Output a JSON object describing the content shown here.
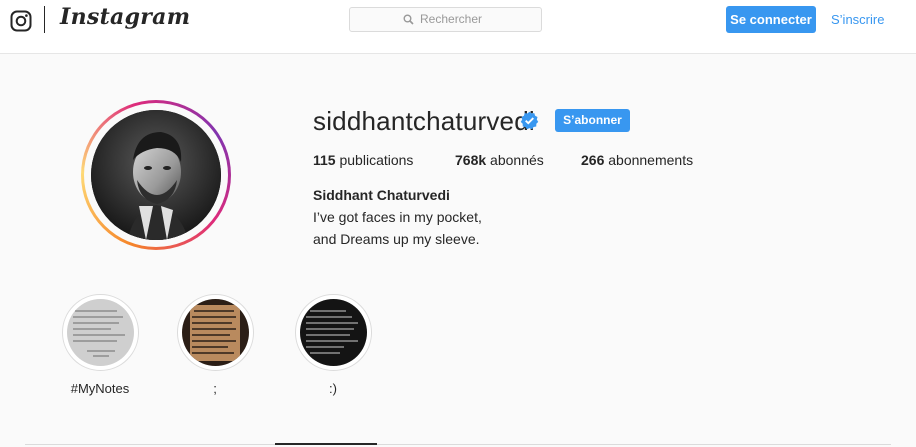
{
  "header": {
    "logo_text": "Instagram",
    "search_placeholder": "Rechercher",
    "login_label": "Se connecter",
    "signup_label": "S’inscrire"
  },
  "profile": {
    "username": "siddhantchaturvedi",
    "verified": true,
    "follow_label": "S’abonner",
    "stats": [
      {
        "count": "115",
        "label": "publications"
      },
      {
        "count": "768k",
        "label": "abonnés"
      },
      {
        "count": "266",
        "label": "abonnements"
      }
    ],
    "full_name": "Siddhant Chaturvedi",
    "bio_lines": [
      "I’ve got faces in my pocket,",
      "and Dreams up my sleeve."
    ]
  },
  "highlights": [
    {
      "label": "#MyNotes"
    },
    {
      "label": ";"
    },
    {
      "label": ":)"
    }
  ],
  "colors": {
    "accent": "#3897f0",
    "text": "#262626",
    "background": "#fafafa",
    "border": "#dbdbdb"
  }
}
